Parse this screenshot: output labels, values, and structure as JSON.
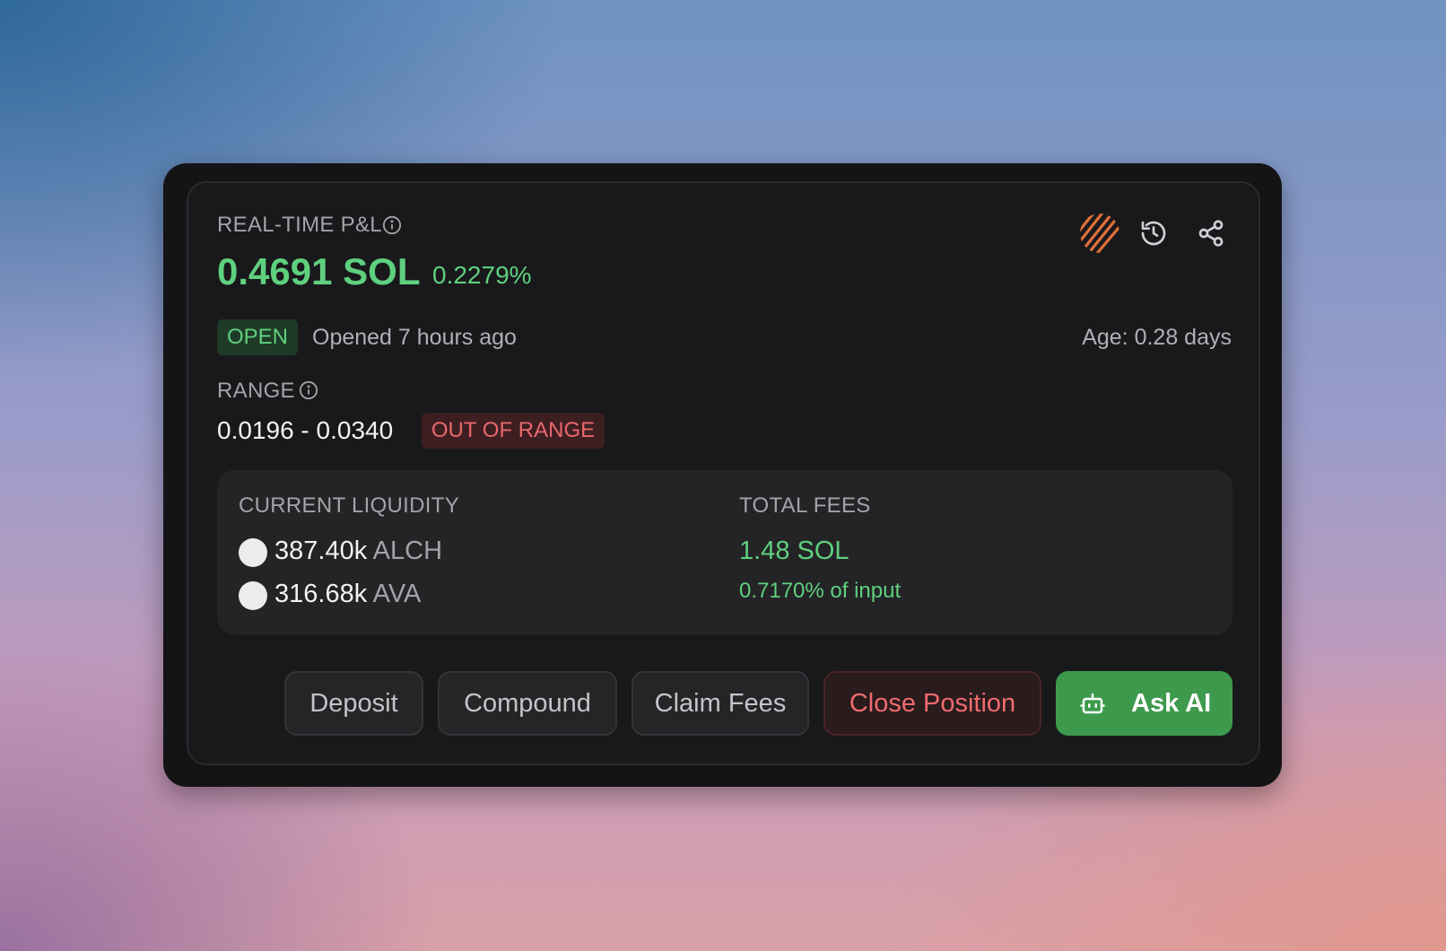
{
  "pnl": {
    "label": "REAL-TIME P&L",
    "value": "0.4691 SOL",
    "percent": "0.2279%"
  },
  "status": {
    "badge": "OPEN",
    "opened": "Opened 7 hours ago",
    "age": "Age: 0.28 days"
  },
  "range": {
    "label": "RANGE",
    "value": "0.0196 - 0.0340",
    "badge": "OUT OF RANGE"
  },
  "liquidity": {
    "label": "CURRENT LIQUIDITY",
    "tokens": [
      {
        "amount": "387.40k",
        "symbol": "ALCH"
      },
      {
        "amount": "316.68k",
        "symbol": "AVA"
      }
    ]
  },
  "fees": {
    "label": "TOTAL FEES",
    "value": "1.48 SOL",
    "percent": "0.7170% of input"
  },
  "actions": {
    "deposit": "Deposit",
    "compound": "Compound",
    "claim_fees": "Claim Fees",
    "close_position": "Close Position",
    "ask_ai": "Ask AI"
  },
  "colors": {
    "positive": "#5fd07e",
    "negative": "#e8686c",
    "ai_button": "#3d9a4c",
    "logo": "#e0703a"
  },
  "icons": {
    "logo": "striped-logo-icon",
    "history": "history-icon",
    "share": "share-icon",
    "info": "info-icon",
    "robot": "robot-icon"
  }
}
